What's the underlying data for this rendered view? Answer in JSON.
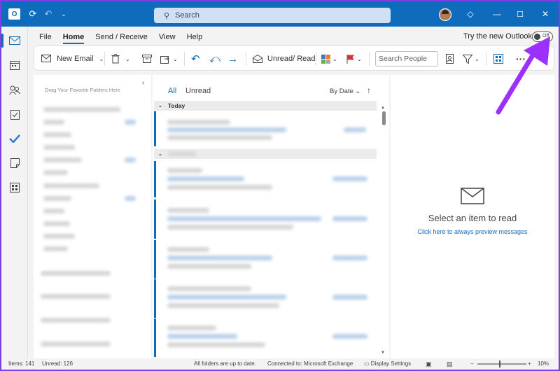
{
  "titlebar": {
    "search_placeholder": "Search",
    "icons": [
      "outlook-logo-icon",
      "sync-icon",
      "undo-icon",
      "customize-icon",
      "avatar",
      "premium-icon",
      "minimize-icon",
      "maximize-icon",
      "close-icon"
    ]
  },
  "menu": {
    "items": [
      "File",
      "Home",
      "Send / Receive",
      "View",
      "Help"
    ],
    "active": "Home",
    "try_new_label": "Try the new Outlook",
    "toggle_state": "Off"
  },
  "ribbon": {
    "new_email": "New Email",
    "unread_read": "Unread/ Read",
    "search_people_placeholder": "Search People",
    "more": "···"
  },
  "folder_pane": {
    "hint": "Drag Your Favorite Folders Here"
  },
  "message_list": {
    "tab_all": "All",
    "tab_unread": "Unread",
    "sort_label": "By Date",
    "group_today": "Today"
  },
  "reading_pane": {
    "title": "Select an item to read",
    "link": "Click here to always preview messages"
  },
  "status": {
    "items": "Items: 141",
    "unread": "Unread: 126",
    "sync": "All folders are up to date.",
    "connection": "Connected to: Microsoft Exchange",
    "display_settings": "Display Settings",
    "zoom": "10%"
  },
  "colors": {
    "accent": "#0f6cbd",
    "frame": "#7b3fe4",
    "annotation": "#9b30ff"
  }
}
